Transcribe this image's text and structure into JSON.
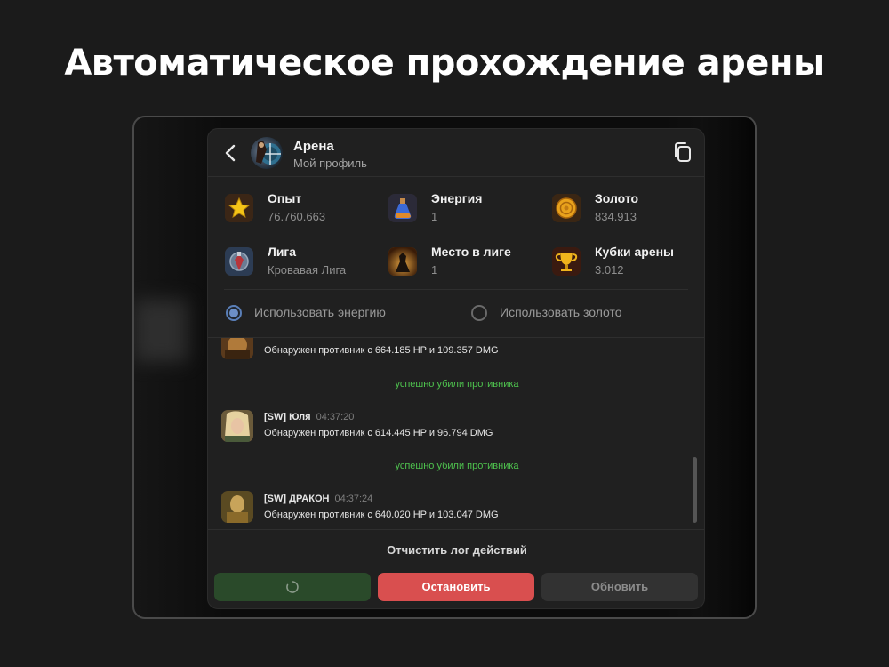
{
  "headline": "Автоматическое прохождение арены",
  "header": {
    "title": "Арена",
    "subtitle": "Мой профиль"
  },
  "stats": [
    {
      "label": "Опыт",
      "value": "76.760.663",
      "icon": "star-icon"
    },
    {
      "label": "Энергия",
      "value": "1",
      "icon": "potion-icon"
    },
    {
      "label": "Золото",
      "value": "834.913",
      "icon": "gold-coin-icon"
    },
    {
      "label": "Лига",
      "value": "Кровавая Лига",
      "icon": "league-icon"
    },
    {
      "label": "Место в лиге",
      "value": "1",
      "icon": "league-place-icon"
    },
    {
      "label": "Кубки арены",
      "value": "3.012",
      "icon": "trophy-icon"
    }
  ],
  "options": {
    "energy": {
      "label": "Использовать энергию",
      "selected": true
    },
    "gold": {
      "label": "Использовать золото",
      "selected": false
    }
  },
  "log": {
    "entries": [
      {
        "name": "",
        "time": "",
        "message": "Обнаружен противник с 664.185 HP и 109.357 DMG"
      },
      {
        "status": "успешно убили противника"
      },
      {
        "name": "[SW] Юля",
        "time": "04:37:20",
        "message": "Обнаружен противник с 614.445 HP и 96.794 DMG"
      },
      {
        "status": "успешно убили противника"
      },
      {
        "name": "[SW] ДРАКОН",
        "time": "04:37:24",
        "message": "Обнаружен противник с 640.020 HP и 103.047 DMG"
      }
    ]
  },
  "actions": {
    "clear_label": "Отчистить лог действий",
    "stop_label": "Остановить",
    "refresh_label": "Обновить"
  },
  "colors": {
    "background": "#1b1b1b",
    "panel": "#202020",
    "accent_blue": "#6c8fc7",
    "success_green": "#4ec24e",
    "stop_red": "#d94f4f",
    "start_green": "#2a4a2a"
  }
}
